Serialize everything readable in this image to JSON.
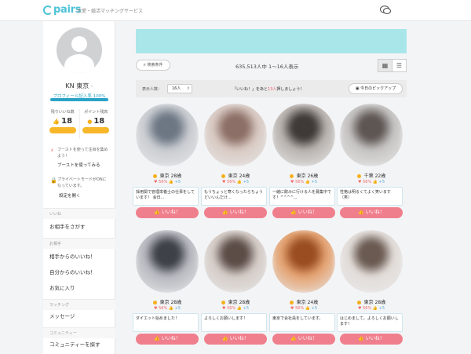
{
  "header": {
    "brand": "pairs",
    "tagline": "恋愛・婚活マッチングサービス"
  },
  "sidebar": {
    "username": "KN 東京",
    "profile_rate_label": "プロフィール記入率",
    "profile_rate_value": "100%",
    "profile_rate": 1.0,
    "likes_label": "残りいいね数",
    "likes_value": "18",
    "points_label": "ポイント残高",
    "points_value": "18",
    "boost_text": "ブーストを使って注目を集めよう！",
    "boost_link": "ブーストを使ってみる",
    "private_text": "プライベートモードがONになっています。",
    "private_link": "設定を開く",
    "section_like": "いいね",
    "search_partner": "お相手をさがす",
    "section_mine": "お相手",
    "likes_from": "相手からのいいね！",
    "likes_mine": "自分からのいいね！",
    "favorites": "お気に入り",
    "section_msg": "マッチング",
    "messages": "メッセージ",
    "section_comm": "コミュニティー",
    "communities": "コミュニティーを探す"
  },
  "toolbar": {
    "search_label": "検索条件",
    "count_text": "635,513人中 1〜16人表示"
  },
  "filterbar": {
    "label": "表示人数：",
    "select_value": "16人",
    "msg_pre": "「いいね！」をあと",
    "msg_num": "13人",
    "msg_post": "押しましょう！",
    "pickup": "今日のピックアップ"
  },
  "cards": [
    {
      "loc": "東京",
      "age": "28歳",
      "match": "56%",
      "count": "+5",
      "comment": "採用関で管理栄養士の仕事をしています！ 会日...",
      "like": "いいね！",
      "color1": "#c9ccd1",
      "color2": "#6d7784"
    },
    {
      "loc": "東京",
      "age": "24歳",
      "match": "56%",
      "count": "+5",
      "comment": "もうちょっと寒くなったらちょうどいいんだけ...",
      "like": "いいね！",
      "color1": "#d8c9c2",
      "color2": "#8c6f66"
    },
    {
      "loc": "東京",
      "age": "26歳",
      "match": "56%",
      "count": "+5",
      "comment": "一緒に飲みに行ける人を募集中です！^^^^...",
      "like": "いいね！",
      "color1": "#b8b2ae",
      "color2": "#3f3a38"
    },
    {
      "loc": "千葉",
      "age": "22歳",
      "match": "56%",
      "count": "+5",
      "comment": "性格は明るくてよく笑います（笑）",
      "like": "いいね！",
      "color1": "#c5c3c2",
      "color2": "#5e5653"
    },
    {
      "loc": "東京",
      "age": "28歳",
      "match": "56%",
      "count": "+5",
      "comment": "ダイエット始めました！",
      "like": "いいね！",
      "color1": "#b6b8bf",
      "color2": "#3e4148"
    },
    {
      "loc": "東京",
      "age": "28歳",
      "match": "56%",
      "count": "+5",
      "comment": "よろしくお願いします！",
      "like": "いいね！",
      "color1": "#d4cbc6",
      "color2": "#5c4d47"
    },
    {
      "loc": "東京",
      "age": "24歳",
      "match": "56%",
      "count": "+5",
      "comment": "東京で会社員をしています。",
      "like": "いいね！",
      "color1": "#e4a271",
      "color2": "#9a4d20"
    },
    {
      "loc": "東京",
      "age": "28歳",
      "match": "56%",
      "count": "+5",
      "comment": "はじめまして。よろしくお願いします！",
      "like": "いいね！",
      "color1": "#e2dcd8",
      "color2": "#6a5a52"
    }
  ]
}
